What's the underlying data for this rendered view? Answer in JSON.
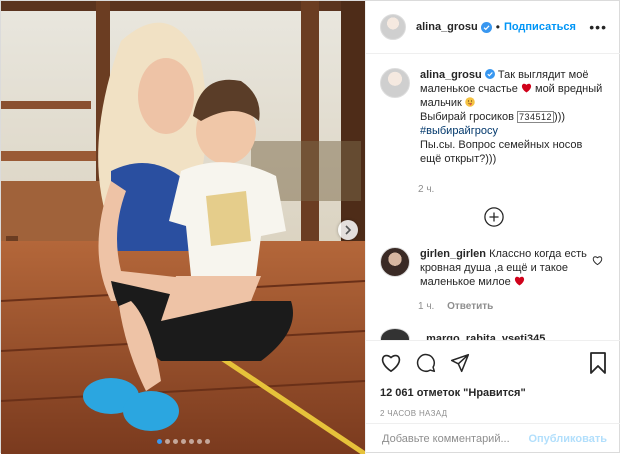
{
  "post": {
    "username": "alina_grosu",
    "follow_label": "Подписаться",
    "more_label": "•••",
    "verified_icon": "verified-badge-icon",
    "accent": "#0095f6"
  },
  "caption": {
    "username": "alina_grosu",
    "line1": "Так выглядит моё маленькое счастье",
    "line1b": "мой вредный мальчик",
    "line2a": "Выбирай гросиков",
    "line2_boxed": "734512",
    "line2b": ")))",
    "hashtag": "#выбирайгросу",
    "line3": "Пы.сы. Вопрос семейных носов ещё открыт?)))",
    "time": "2 ч."
  },
  "comment": {
    "username": "girlen_girlen",
    "text": "Классно когда есть кровная душа ,а ещё и такое маленькое милое",
    "time": "1 ч.",
    "reply_label": "Ответить"
  },
  "next_comment": {
    "username": "_margo_rabita_yseti345"
  },
  "stats": {
    "likes": "12 061 отметок \"Нравится\"",
    "posted": "2 ЧАСОВ НАЗАД"
  },
  "add_comment": {
    "placeholder": "Добавьте комментарий...",
    "publish_label": "Опубликовать",
    "publish_color": "#b2dffc"
  },
  "carousel": {
    "dots_total": 7,
    "active_index": 0
  }
}
